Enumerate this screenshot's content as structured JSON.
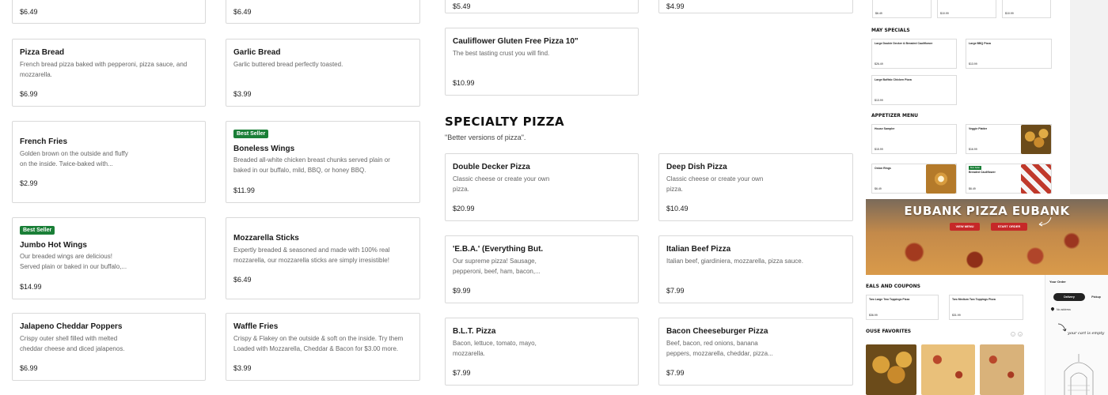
{
  "menu_left": [
    {
      "id": "prev-left-1",
      "price": "$6.49"
    },
    {
      "id": "pizza-bread",
      "name": "Pizza Bread",
      "desc": "French bread pizza baked with pepperoni, pizza sauce, and mozzarella.",
      "price": "$6.99"
    },
    {
      "id": "french-fries",
      "name": "French Fries",
      "desc": "Golden brown on the outside and fluffy on the inside. Twice-baked with...",
      "price": "$2.99"
    },
    {
      "id": "jumbo-hot-wings",
      "badge": "Best Seller",
      "name": "Jumbo Hot Wings",
      "desc": "Our breaded wings are delicious! Served plain or baked in our buffalo,...",
      "price": "$14.99"
    },
    {
      "id": "jalapeno-poppers",
      "name": "Jalapeno Cheddar Poppers",
      "desc": "Crispy outer shell filled with melted cheddar cheese and diced jalapenos.",
      "price": "$6.99"
    }
  ],
  "menu_mid": [
    {
      "id": "prev-mid-1",
      "price": "$6.49"
    },
    {
      "id": "garlic-bread",
      "name": "Garlic Bread",
      "desc": "Garlic buttered bread perfectly toasted.",
      "price": "$3.99"
    },
    {
      "id": "boneless-wings",
      "badge": "Best Seller",
      "name": "Boneless Wings",
      "desc": "Breaded all-white chicken breast chunks served plain or baked in our buffalo, mild, BBQ, or honey BBQ.",
      "price": "$11.99"
    },
    {
      "id": "mozzarella-sticks",
      "name": "Mozzarella Sticks",
      "desc": "Expertly breaded & seasoned and made with 100% real mozzarella, our mozzarella sticks are simply irresistible!",
      "price": "$6.49"
    },
    {
      "id": "waffle-fries",
      "name": "Waffle Fries",
      "desc": "Crispy & Flakey on the outside & soft on the inside. Try them Loaded with Mozzarella, Cheddar & Bacon for $3.00 more.",
      "price": "$3.99"
    }
  ],
  "gluten_free": {
    "top_prices": [
      "$5.49",
      "$4.99"
    ],
    "name": "Cauliflower Gluten Free Pizza 10\"",
    "desc": "The best tasting crust you will find.",
    "price": "$10.99"
  },
  "specialty": {
    "title": "SPECIALTY PIZZA",
    "subtitle": "\"Better versions of pizza\".",
    "items": [
      {
        "id": "double-decker",
        "name": "Double Decker Pizza",
        "desc": "Classic cheese or create your own pizza.",
        "price": "$20.99"
      },
      {
        "id": "deep-dish",
        "name": "Deep Dish Pizza",
        "desc": "Classic cheese or create your own pizza.",
        "price": "$10.49"
      },
      {
        "id": "eba",
        "name": "'E.B.A.' (Everything But...",
        "desc": "Our supreme pizza! Sausage, pepperoni, beef, ham, bacon,...",
        "price": "$9.99"
      },
      {
        "id": "italian-beef",
        "name": "Italian Beef Pizza",
        "desc": "Italian beef, giardiniera, mozzarella, pizza sauce.",
        "price": "$7.99"
      },
      {
        "id": "blt",
        "name": "B.L.T. Pizza",
        "desc": "Bacon, lettuce, tomato, mayo, mozzarella.",
        "price": "$7.99"
      },
      {
        "id": "bacon-cheeseburger",
        "name": "Bacon Cheeseburger Pizza",
        "desc": "Beef, bacon, red onions, banana peppers, mozzarella, cheddar, pizza...",
        "price": "$7.99"
      }
    ]
  },
  "preview": {
    "top_prices": [
      "$6.49",
      "$10.99",
      "$10.99"
    ],
    "may_specials": "MAY SPECIALS",
    "specials": [
      {
        "name": "Large Double Decker & Breaded Cauliflower",
        "price": "$26.49"
      },
      {
        "name": "Large BBQ Pizza",
        "price": "$13.99"
      },
      {
        "name": "Large Buffalo Chicken Pizza",
        "price": "$13.99"
      }
    ],
    "appetizer_menu": "APPETIZER MENU",
    "appetizers": [
      {
        "name": "House Sampler",
        "price": "$15.99"
      },
      {
        "name": "Veggie Platter",
        "price": "$16.99"
      },
      {
        "name": "Onion Rings",
        "price": "$6.49"
      },
      {
        "name": "Breaded Cauliflower",
        "badge": "Best Seller",
        "price": "$6.49"
      }
    ],
    "hero_title": "EUBANK PIZZA EUBANK",
    "view_menu": "VIEW MENU",
    "start_order": "START ORDER",
    "deals_title": "EALS AND COUPONS",
    "deals": [
      {
        "name": "Two Large Two Toppings Pizza",
        "price": "$36.99"
      },
      {
        "name": "Two Medium Two Toppings Pizza",
        "price": "$31.99"
      }
    ],
    "favorites_title": "OUSE FAVORITES",
    "your_order": "Your Order",
    "delivery": "Delivery",
    "pickup": "Pickup",
    "no_address": "No address",
    "cart_empty": "your cart is empty"
  },
  "colors": {
    "badge": "#1a7f37",
    "hero_button": "#c62828",
    "border": "#d9d9d9"
  }
}
